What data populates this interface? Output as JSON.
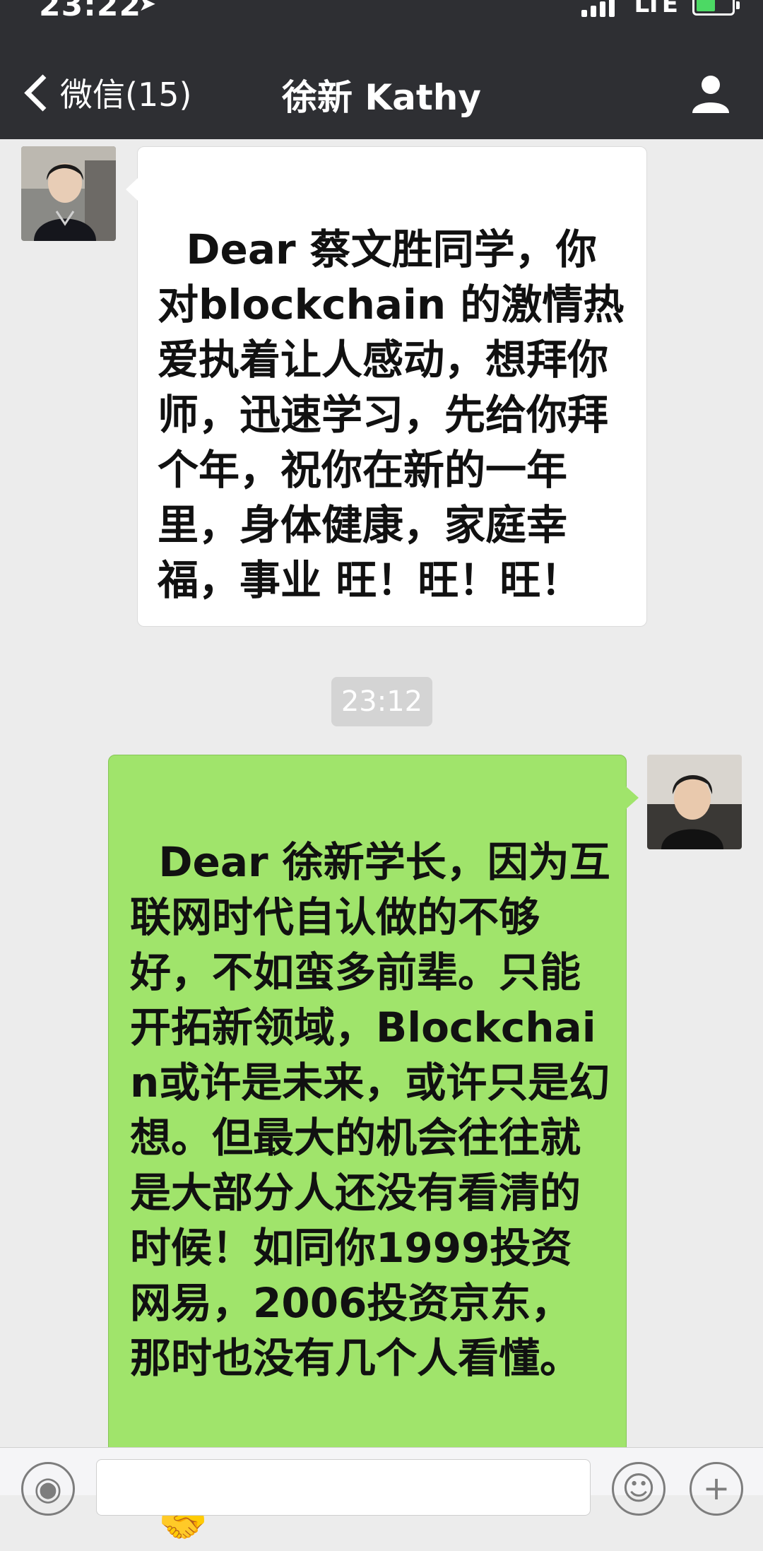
{
  "status_bar": {
    "time": "23:22",
    "network": "LTE",
    "location_icon": "location-arrow-icon",
    "signal_icon": "signal-bars-icon",
    "battery_icon": "battery-charging-icon"
  },
  "nav": {
    "back_label": "微信(15)",
    "title": "徐新 Kathy",
    "back_icon": "chevron-left-icon",
    "profile_icon": "person-icon"
  },
  "messages": [
    {
      "direction": "incoming",
      "text": "Dear 蔡文胜同学，你对blockchain 的激情热爱执着让人感动，想拜你师，迅速学习，先给你拜个年，祝你在新的一年里，身体健康，家庭幸福，事业 旺！旺！旺！"
    },
    {
      "direction": "outgoing",
      "text": "Dear 徐新学长，因为互联网时代自认做的不够好，不如蛮多前辈。只能开拓新领域，Blockchain或许是未来，或许只是幻想。但最大的机会往往就是大部分人还没有看清的时候！如同你1999投资网易，2006投资京东，那时也没有几个人看懂。",
      "emoji": "🤝"
    }
  ],
  "timestamp": "23:12",
  "input_bar": {
    "voice_icon": "voice-icon",
    "emoji_icon": "emoji-icon",
    "plus_icon": "plus-icon",
    "placeholder": ""
  },
  "colors": {
    "header_bg": "#2e2f33",
    "chat_bg": "#ececec",
    "outgoing_bubble": "#a0e46b",
    "incoming_bubble": "#ffffff"
  }
}
